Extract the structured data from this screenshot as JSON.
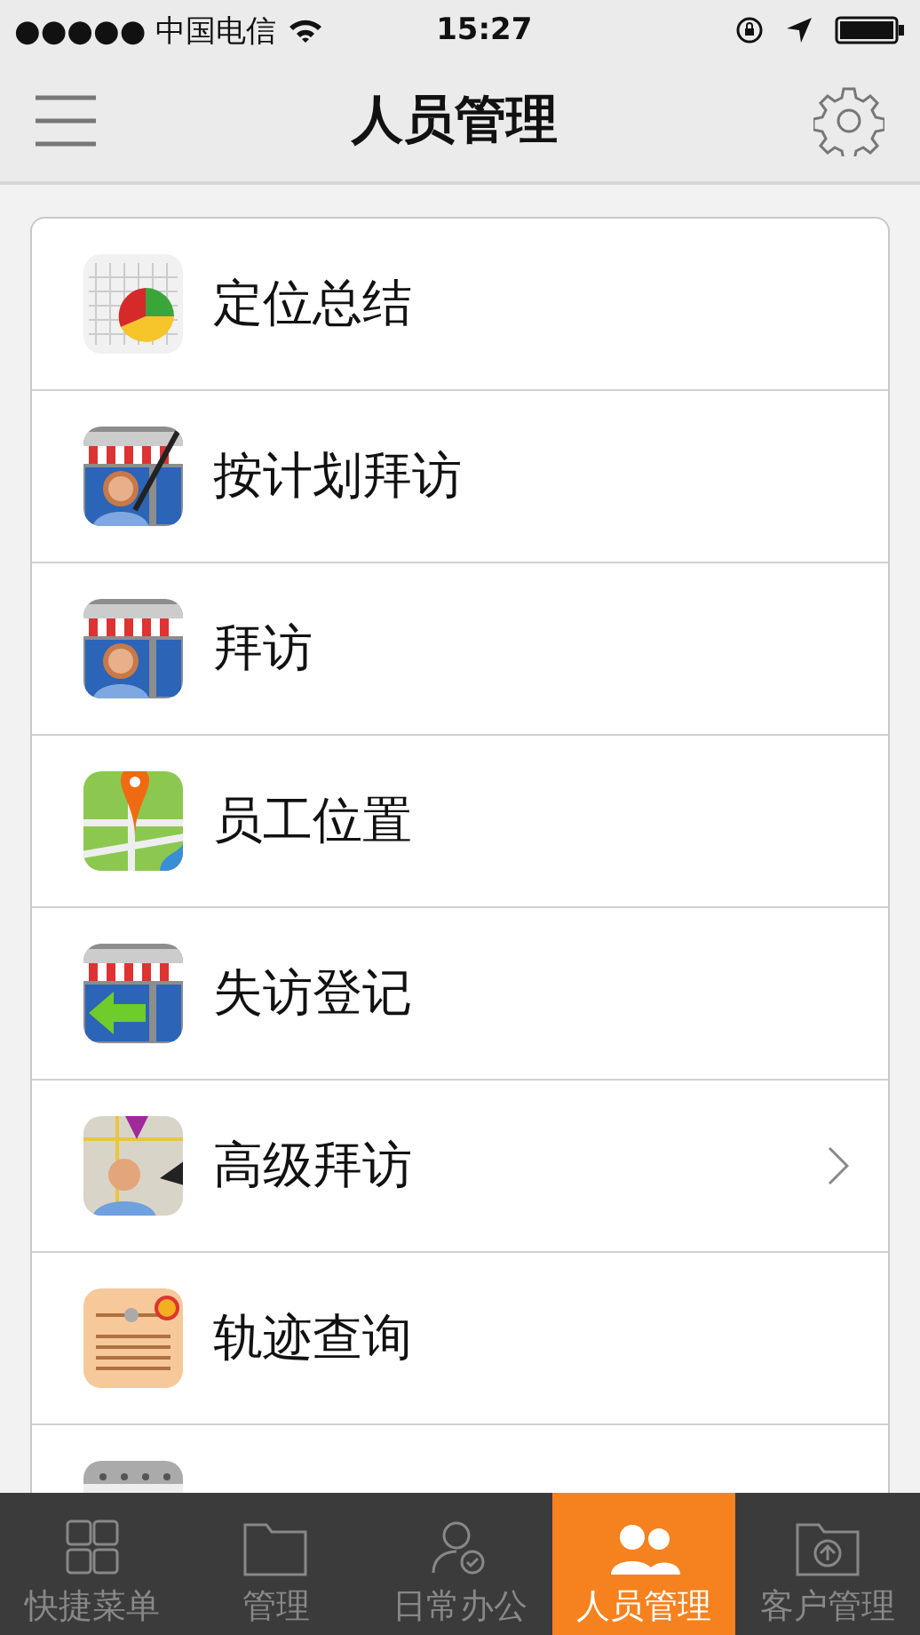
{
  "status_bar": {
    "carrier": "●●●●● 中国电信",
    "time": "15:27"
  },
  "nav_bar": {
    "title": "人员管理"
  },
  "menu": [
    {
      "label": "定位总结",
      "kind": "chart",
      "chevron": false
    },
    {
      "label": "按计划拜访",
      "kind": "store-pen",
      "chevron": false
    },
    {
      "label": "拜访",
      "kind": "store",
      "chevron": false
    },
    {
      "label": "员工位置",
      "kind": "map-pin",
      "chevron": false
    },
    {
      "label": "失访登记",
      "kind": "store-arrow",
      "chevron": false
    },
    {
      "label": "高级拜访",
      "kind": "map-person",
      "chevron": true
    },
    {
      "label": "轨迹查询",
      "kind": "certificate",
      "chevron": false
    },
    {
      "kind": "calendar"
    }
  ],
  "tab_bar": [
    {
      "label": "快捷菜单",
      "kind": "grid",
      "selected": false
    },
    {
      "label": "管理",
      "kind": "folder",
      "selected": false
    },
    {
      "label": "日常办公",
      "kind": "person-check",
      "selected": false
    },
    {
      "label": "人员管理",
      "kind": "people",
      "selected": true
    },
    {
      "label": "客户管理",
      "kind": "folder-upload",
      "selected": false
    }
  ]
}
